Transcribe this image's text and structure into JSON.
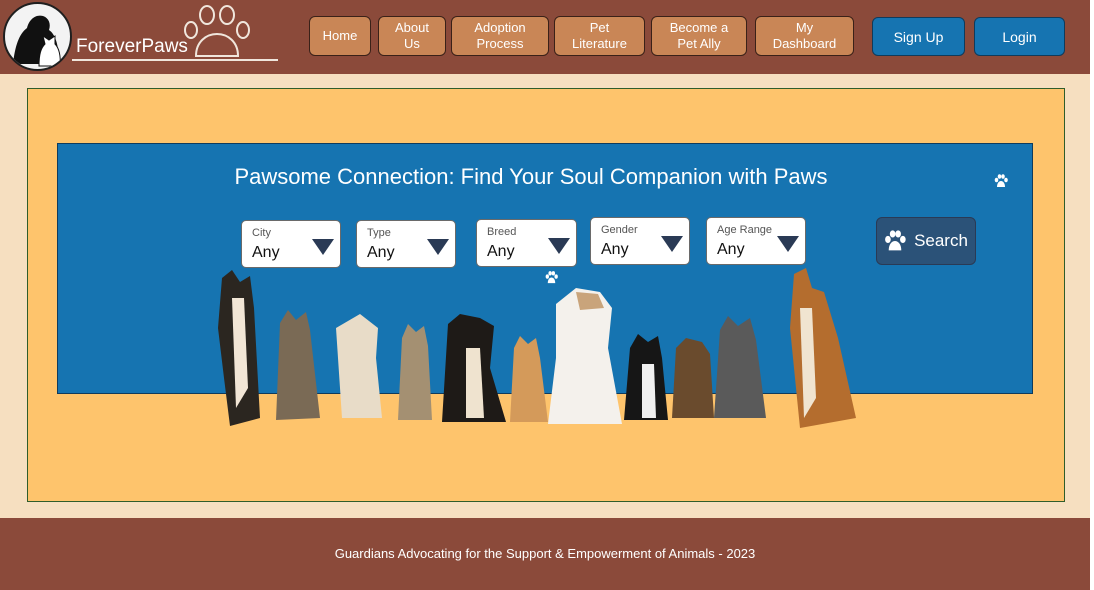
{
  "brand": {
    "name": "ForeverPaws"
  },
  "nav": {
    "items": [
      {
        "label": "Home"
      },
      {
        "label": "About\nUs"
      },
      {
        "label": "Adoption\nProcess"
      },
      {
        "label": "Pet\nLiterature"
      },
      {
        "label": "Become a\nPet Ally"
      },
      {
        "label": "My\nDashboard"
      }
    ],
    "signup_label": "Sign Up",
    "login_label": "Login"
  },
  "hero": {
    "title": "Pawsome Connection: Find Your Soul Companion with Paws",
    "filters": [
      {
        "label": "City",
        "value": "Any"
      },
      {
        "label": "Type",
        "value": "Any"
      },
      {
        "label": "Breed",
        "value": "Any"
      },
      {
        "label": "Gender",
        "value": "Any"
      },
      {
        "label": "Age Range",
        "value": "Any"
      }
    ],
    "search_label": "Search"
  },
  "footer": {
    "text": "Guardians Advocating for the Support & Empowerment of Animals - 2023"
  },
  "colors": {
    "header": "#8b4a3a",
    "nav_button": "#c98656",
    "accent_blue": "#1674b1",
    "main_bg": "#fec46c",
    "page_bg": "#f6dfc0"
  }
}
